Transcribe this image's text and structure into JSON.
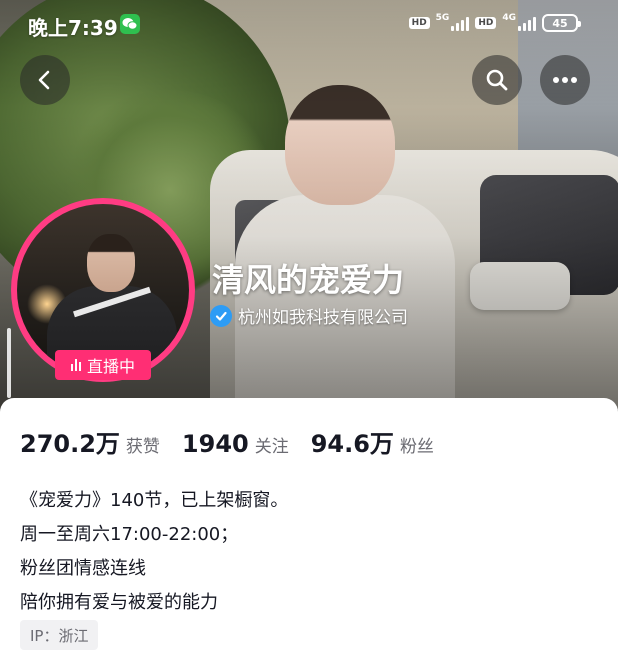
{
  "status_bar": {
    "time": "晚上7:39",
    "hd_label": "HD",
    "network_1": "5G",
    "network_2": "4G",
    "battery": "45"
  },
  "nav": {
    "back_icon": "chevron-left-icon",
    "search_icon": "search-icon",
    "more_icon": "more-dots-icon"
  },
  "profile": {
    "name": "清风的宠爱力",
    "verified_org": "杭州如我科技有限公司",
    "live_label": "直播中",
    "ring_color": "#ff3c83",
    "live_color": "#ff2e74",
    "verified_color": "#2d9cf5"
  },
  "stats": [
    {
      "value": "270.2万",
      "label": "获赞"
    },
    {
      "value": "1940",
      "label": "关注"
    },
    {
      "value": "94.6万",
      "label": "粉丝"
    }
  ],
  "bio": [
    "《宠爱力》140节，已上架橱窗。",
    "周一至周六17:00-22:00；",
    "粉丝团情感连线",
    "陪你拥有爱与被爱的能力"
  ],
  "ip": "IP：浙江"
}
